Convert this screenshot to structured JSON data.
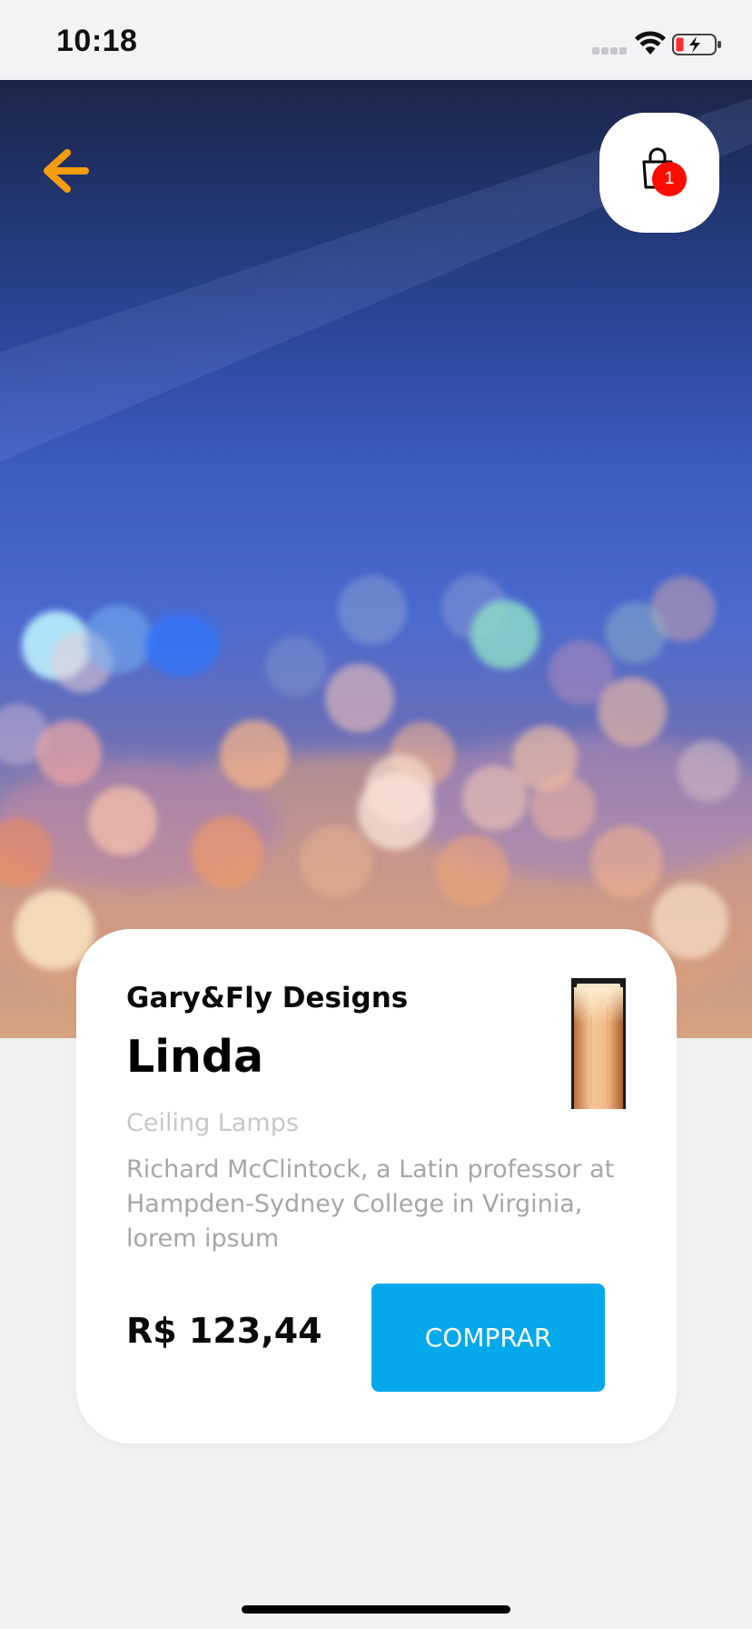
{
  "status_bar": {
    "time": "10:18"
  },
  "header": {
    "back_icon": "arrow-left-icon",
    "cart_icon": "shopping-bag-icon",
    "cart_badge_count": "1"
  },
  "product": {
    "brand": "Gary&Fly Designs",
    "name": "Linda",
    "category": "Ceiling Lamps",
    "description": "Richard McClintock, a Latin professor at Hampden-Sydney College in Virginia, lorem ipsum",
    "price": "R$ 123,44",
    "buy_label": "COMPRAR"
  },
  "colors": {
    "accent_orange": "#f39c12",
    "buy_button": "#03a9ea",
    "badge_red": "#ff0a00"
  }
}
